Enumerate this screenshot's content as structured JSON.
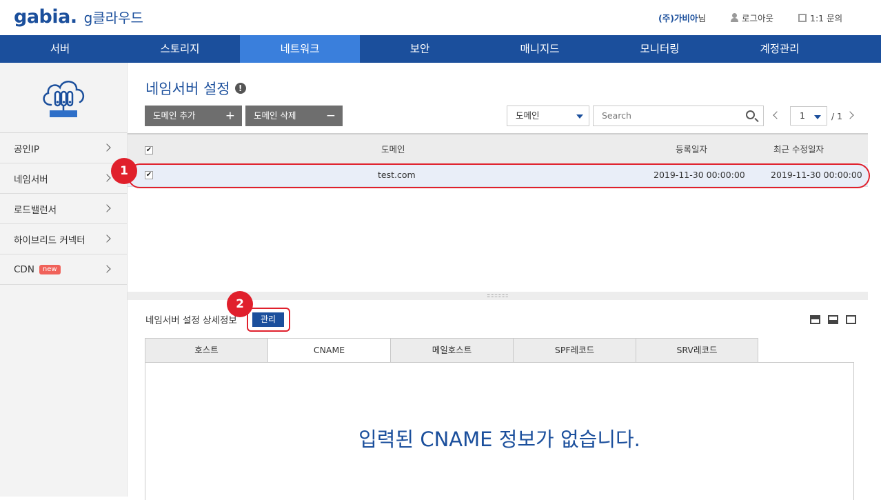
{
  "header": {
    "logo_main": "gabia.",
    "logo_sub": "g클라우드",
    "company_name": "(주)가비아",
    "company_suffix": "님",
    "logout_label": "로그아웃",
    "inquiry_label": "1:1 문의"
  },
  "nav": {
    "items": [
      "서버",
      "스토리지",
      "네트워크",
      "보안",
      "매니지드",
      "모니터링",
      "계정관리"
    ],
    "active": "네트워크"
  },
  "sidebar": {
    "items": [
      {
        "label": "공인IP"
      },
      {
        "label": "네임서버"
      },
      {
        "label": "로드밸런서"
      },
      {
        "label": "하이브리드 커넥터"
      },
      {
        "label": "CDN",
        "badge": "new"
      }
    ]
  },
  "main": {
    "title": "네임서버 설정",
    "info_icon": "!",
    "add_domain_label": "도메인 추가",
    "delete_domain_label": "도메인 삭제",
    "filter_select": "도메인",
    "search_placeholder": "Search",
    "page_current": "1",
    "page_total": "/ 1",
    "table": {
      "headers": [
        "도메인",
        "등록일자",
        "최근 수정일자"
      ],
      "rows": [
        {
          "domain": "test.com",
          "registered": "2019-11-30 00:00:00",
          "modified": "2019-11-30 00:00:00",
          "checked": true
        }
      ]
    }
  },
  "detail": {
    "title": "네임서버 설정 상세정보",
    "manage_label": "관리",
    "tabs": [
      "호스트",
      "CNAME",
      "메일호스트",
      "SPF레코드",
      "SRV레코드"
    ],
    "active_tab": "CNAME",
    "empty_message": "입력된 CNAME 정보가 없습니다."
  },
  "annotations": {
    "marker_1": "1",
    "marker_2": "2",
    "highlight_color": "#e0202c"
  },
  "colors": {
    "brand": "#1b4f9c",
    "nav_active": "#3a7fdc"
  }
}
